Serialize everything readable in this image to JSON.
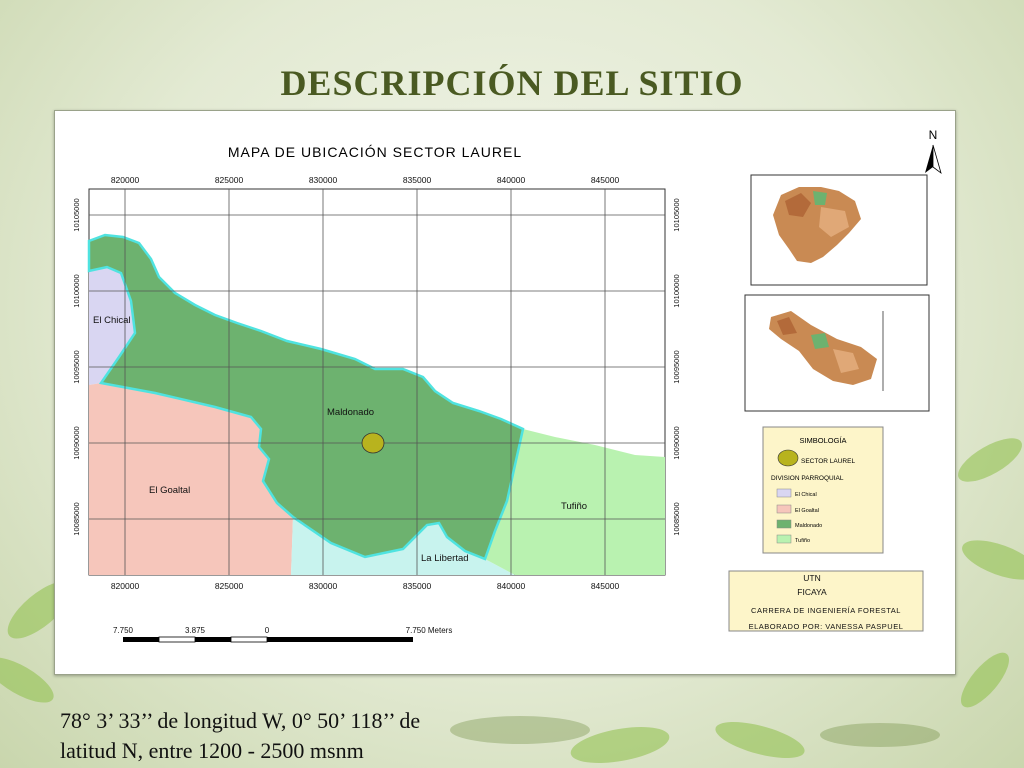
{
  "slide": {
    "title": "DESCRIPCIÓN DEL SITIO",
    "caption_line1": "78° 3’ 33’’ de longitud  W, 0° 50’ 118’’ de",
    "caption_line2": "latitud N, entre 1200 - 2500 msnm"
  },
  "map": {
    "title": "MAPA DE UBICACIÓN SECTOR LAUREL",
    "north_label": "N",
    "x_ticks": [
      "820000",
      "825000",
      "830000",
      "835000",
      "840000",
      "845000"
    ],
    "y_ticks": [
      "10105000",
      "10100000",
      "10095000",
      "10090000",
      "10085000"
    ],
    "regions": [
      {
        "name": "El Chical",
        "color": "#d9d6f2"
      },
      {
        "name": "El Goaltal",
        "color": "#f6c6bb"
      },
      {
        "name": "Maldonado",
        "color": "#6db26f"
      },
      {
        "name": "Tufiño",
        "color": "#b9f2b0"
      },
      {
        "name": "La Libertad",
        "color": "#c8f3ee"
      }
    ],
    "scale_bar": {
      "labels": [
        "7.750",
        "3.875",
        "0",
        "7.750 Meters"
      ]
    }
  },
  "legend": {
    "title": "SIMBOLOGÍA",
    "point_label": "SECTOR LAUREL",
    "point_color": "#b8b31e",
    "division_title": "DIVISION PARROQUIAL",
    "items": [
      {
        "label": "El Chical",
        "color": "#d9d6f2"
      },
      {
        "label": "El Goaltal",
        "color": "#f6c6bb"
      },
      {
        "label": "Maldonado",
        "color": "#6db26f"
      },
      {
        "label": "Tufiño",
        "color": "#b9f2b0"
      }
    ]
  },
  "info_box": {
    "line1": "UTN",
    "line2": "FICAYA",
    "line3": "CARRERA DE INGENIERÍA FORESTAL",
    "line4": "ELABORADO POR: VANESSA PASPUEL"
  },
  "colors": {
    "title": "#4a5a22",
    "boundary": "#4fe3e0",
    "info_box_bg": "#fdf5c9"
  }
}
